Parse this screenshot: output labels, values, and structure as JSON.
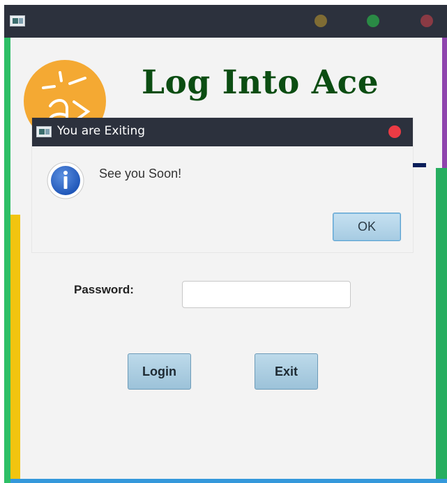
{
  "window": {
    "title": "",
    "app_icon": "window-app-icon",
    "controls": [
      {
        "name": "minimize",
        "color": "#7f6c34"
      },
      {
        "name": "maximize",
        "color": "#2a8a45"
      },
      {
        "name": "close",
        "color": "#8a3a44"
      }
    ]
  },
  "header": {
    "logo_icon": "ace-logo",
    "title": "Log Into Ace"
  },
  "form": {
    "password_label": "Password:",
    "password_value": "",
    "login_label": "Login",
    "exit_label": "Exit"
  },
  "dialog": {
    "title": "You are Exiting",
    "message": "See you Soon!",
    "icon": "info-icon",
    "ok_label": "OK",
    "close_color": "#ec3b44"
  },
  "colors": {
    "titlebar": "#2c313d",
    "heading": "#0b4d12",
    "logo": "#f4a933",
    "border_green": "#2dbf66",
    "border_yellow": "#f2c40f",
    "border_purple": "#8e44ad",
    "border_blue": "#3498db"
  }
}
